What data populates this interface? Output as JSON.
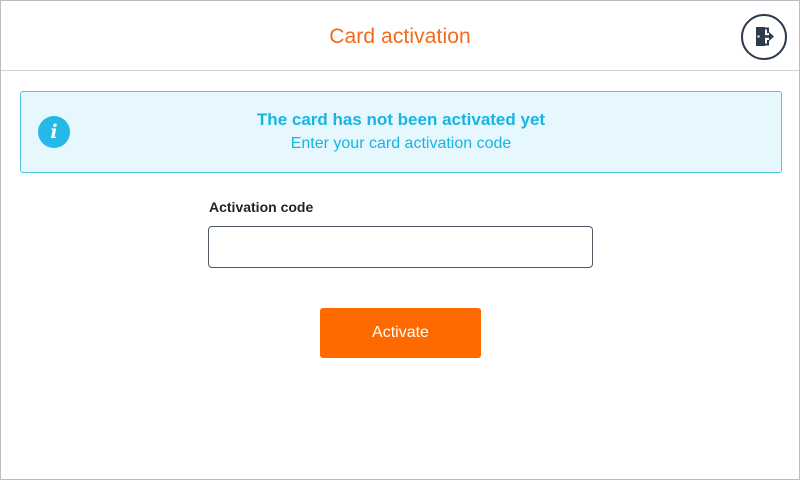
{
  "header": {
    "title": "Card activation",
    "logout_icon": "logout-icon"
  },
  "colors": {
    "accent": "#f26a1b",
    "button": "#ff6a00",
    "info": "#18b4e3",
    "info_background": "#e6f8fd",
    "info_border": "#51c6e8"
  },
  "alert": {
    "icon": "info-icon",
    "icon_glyph": "i",
    "title": "The card has not been activated yet",
    "subtitle": "Enter your card activation code"
  },
  "form": {
    "label": "Activation code",
    "input_value": "",
    "input_placeholder": "",
    "submit_label": "Activate"
  }
}
